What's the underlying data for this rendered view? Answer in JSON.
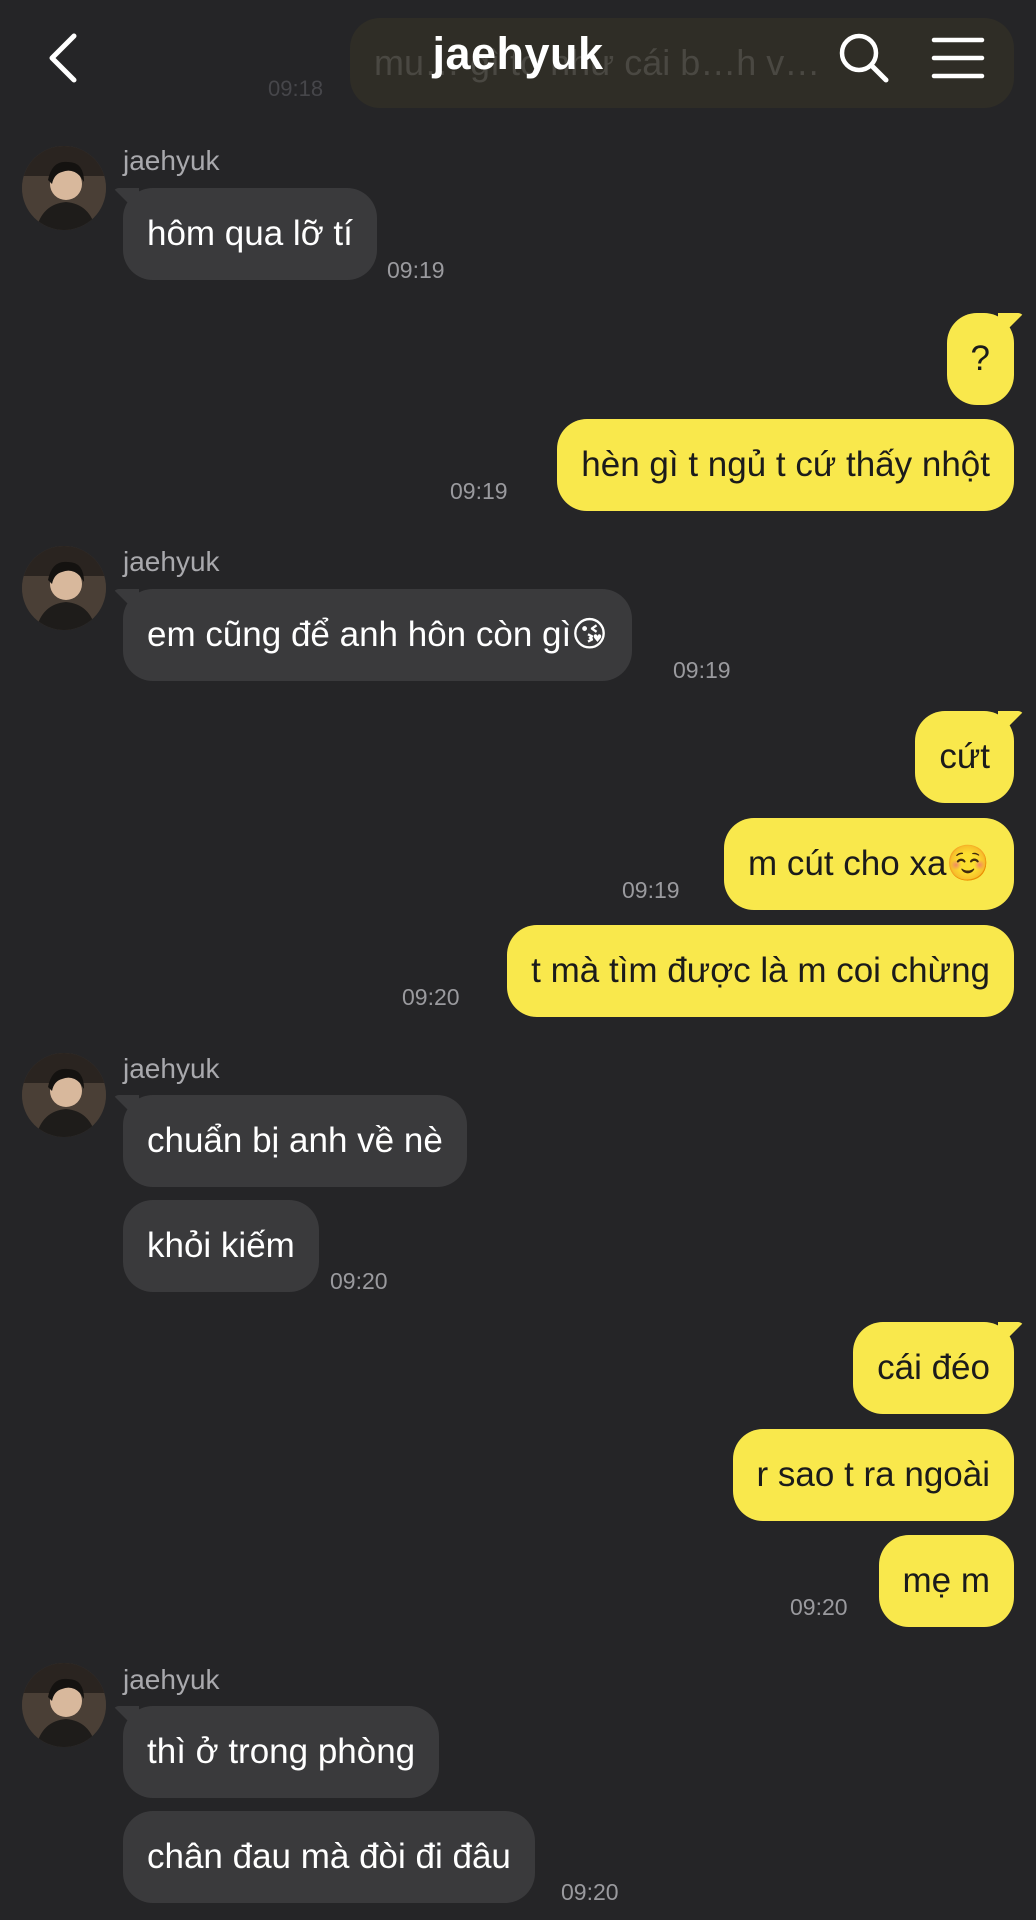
{
  "header": {
    "title": "jaehyuk",
    "ghost_text": "mu… gì to như cái b…h v…",
    "ghost_time": "09:18"
  },
  "messages": [
    {
      "sender": "jaehyuk",
      "text": "hôm qua lỡ tí",
      "time": "09:19"
    },
    {
      "text": "?"
    },
    {
      "text": "hèn gì t ngủ t cứ thấy nhột",
      "time": "09:19"
    },
    {
      "sender": "jaehyuk",
      "text": "em cũng để anh hôn còn gì😘",
      "time": "09:19"
    },
    {
      "text": "cứt"
    },
    {
      "text": "m cút cho xa☺️",
      "time": "09:19"
    },
    {
      "text": "t mà tìm được là m coi chừng",
      "time": "09:20"
    },
    {
      "sender": "jaehyuk",
      "text": "chuẩn bị anh về nè"
    },
    {
      "text": "khỏi kiếm",
      "time": "09:20"
    },
    {
      "text": "cái đéo"
    },
    {
      "text": "r sao t ra ngoài"
    },
    {
      "text": "mẹ m",
      "time": "09:20"
    },
    {
      "sender": "jaehyuk",
      "text": "thì ở trong phòng"
    },
    {
      "text": "chân đau mà đòi đi đâu",
      "time": "09:20"
    }
  ]
}
